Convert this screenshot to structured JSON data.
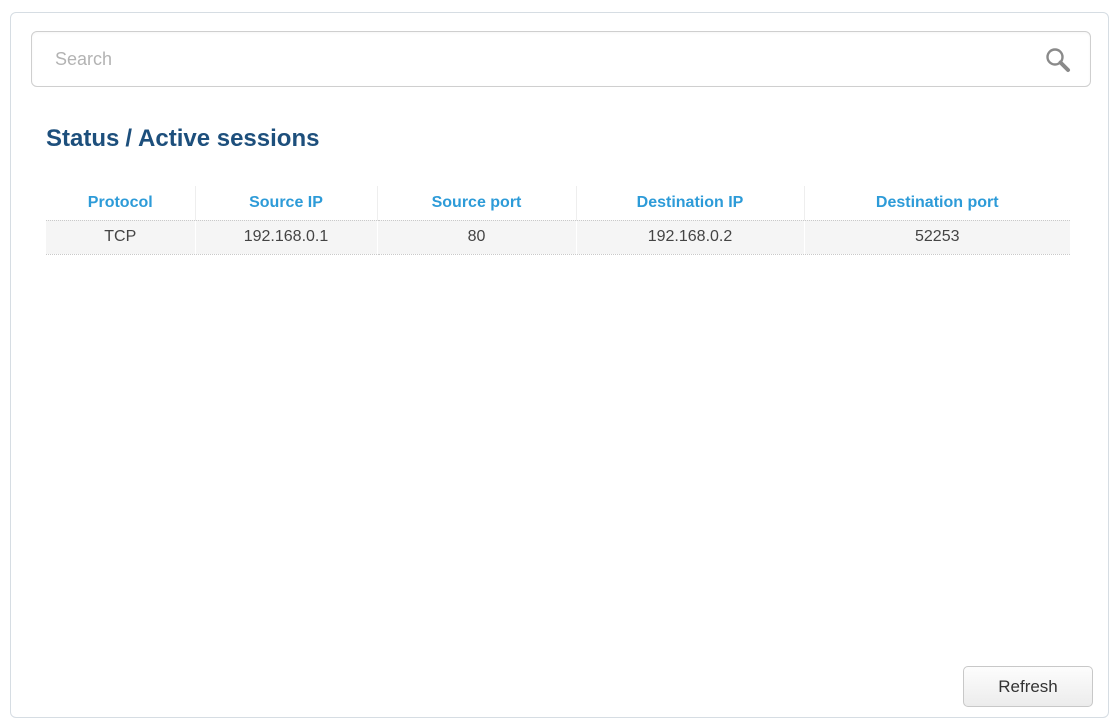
{
  "search": {
    "placeholder": "Search",
    "value": ""
  },
  "breadcrumb": {
    "section": "Status",
    "separator": "/",
    "page": "Active sessions"
  },
  "table": {
    "columns": [
      "Protocol",
      "Source IP",
      "Source port",
      "Destination IP",
      "Destination port"
    ],
    "rows": [
      [
        "TCP",
        "192.168.0.1",
        "80",
        "192.168.0.2",
        "52253"
      ]
    ]
  },
  "actions": {
    "refresh_label": "Refresh"
  },
  "colors": {
    "title": "#1d4f7c",
    "column_header": "#2d9bd8",
    "row_background": "#f5f5f5"
  },
  "icons": {
    "search": "search-icon"
  }
}
